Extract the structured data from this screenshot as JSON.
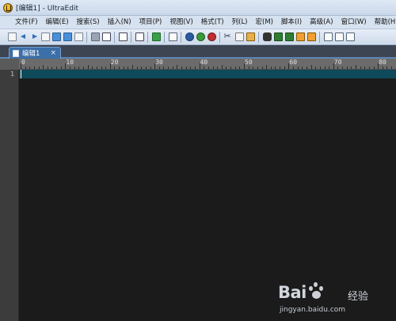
{
  "window": {
    "title": "[编辑1] - UltraEdit"
  },
  "menu": [
    "文件(F)",
    "编辑(E)",
    "搜索(S)",
    "插入(N)",
    "项目(P)",
    "视图(V)",
    "格式(T)",
    "列(L)",
    "宏(M)",
    "脚本(I)",
    "高级(A)",
    "窗口(W)",
    "帮助(H)"
  ],
  "toolbar": {
    "icons": [
      "new-file-icon",
      "back-arrow-icon",
      "forward-arrow-icon",
      "new-document-icon",
      "open-folder-icon",
      "open-project-icon",
      "save-icon",
      "print-icon",
      "print-preview-icon",
      "properties-icon",
      "page-icon",
      "column-mode-icon",
      "word-wrap-icon",
      "browser-icon",
      "ftp-icon",
      "close-icon",
      "cut-icon",
      "copy-icon",
      "paste-icon",
      "find-icon",
      "replace-icon",
      "find-in-files-icon",
      "toggle-panel-icon",
      "output-window-icon",
      "list-panel-icon",
      "function-list-icon"
    ]
  },
  "tabs": [
    {
      "label": "编辑1",
      "close": "×",
      "active": true
    }
  ],
  "ruler": {
    "labels": [
      "0",
      "10",
      "20",
      "30",
      "40",
      "50",
      "60",
      "70",
      "80"
    ]
  },
  "editor": {
    "line_numbers": [
      "1"
    ],
    "content": ""
  },
  "watermark": {
    "brand_left": "Bai",
    "brand_right": "经验",
    "url": "jingyan.baidu.com"
  },
  "colors": {
    "editor_bg": "#1b1b1b",
    "current_line": "#0f4a5a",
    "tab_active": "#3c6fa8",
    "ruler_bg": "#6b6b6b"
  }
}
